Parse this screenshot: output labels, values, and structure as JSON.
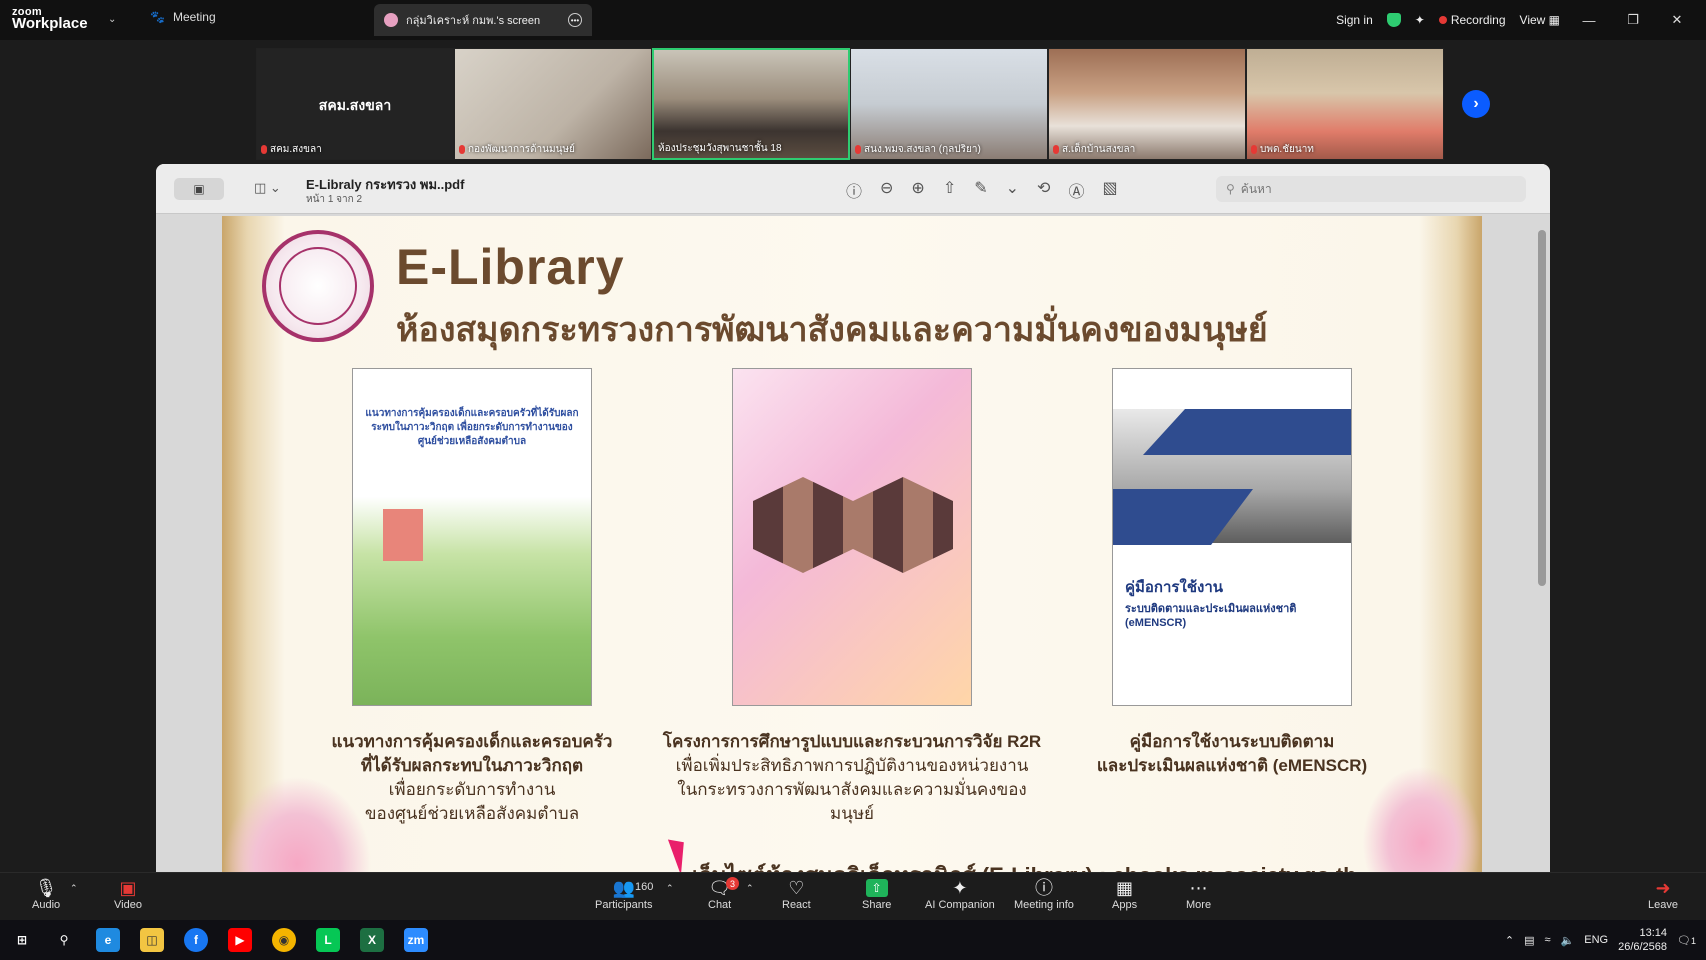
{
  "app": {
    "brand_line1": "zoom",
    "brand_line2": "Workplace",
    "meeting_tab": "Meeting",
    "screen_tab": "กลุ่มวิเคราะห์ กมพ.'s screen",
    "sign_in": "Sign in",
    "recording": "Recording",
    "view": "View"
  },
  "participants_strip": [
    {
      "name": "สคม.สงขลา",
      "big": "สคม.สงขลา",
      "active": false
    },
    {
      "name": "กองพัฒนาการด้านมนุษย์",
      "active": false
    },
    {
      "name": "ห้องประชุมวังสุพานชาชั้น 18",
      "active": true
    },
    {
      "name": "สนง.พมจ.สงขลา (กุลปริยา)",
      "active": false
    },
    {
      "name": "ส.เด็กบ้านสงขลา",
      "active": false
    },
    {
      "name": "บพด.ชัยนาท",
      "active": false
    }
  ],
  "viewer": {
    "file_name": "E-Libraly กระทรวง พม..pdf",
    "page_info": "หน้า 1 จาก 2",
    "search_placeholder": "ค้นหา"
  },
  "page": {
    "title": "E-Library",
    "subtitle": "ห้องสมุดกระทรวงการพัฒนาสังคมและความมั่นคงของมนุษย์",
    "card1_text": "แนวทางการคุ้มครองเด็กและครอบครัวที่ได้รับผลกระทบในภาวะวิกฤต เพื่อยกระดับการทำงานของศูนย์ช่วยเหลือสังคมตำบล",
    "card3_title": "คู่มือการใช้งาน",
    "card3_sub": "ระบบติดตามและประเมินผลแห่งชาติ (eMENSCR)",
    "captions": [
      {
        "bold1": "แนวทางการคุ้มครองเด็กและครอบครัว",
        "bold2": "ที่ได้รับผลกระทบในภาวะวิกฤต",
        "line3": "เพื่อยกระดับการทำงาน",
        "line4": "ของศูนย์ช่วยเหลือสังคมตำบล"
      },
      {
        "bold1": "โครงการการศึกษารูปแบบและกระบวนการวิจัย R2R",
        "line2": "เพื่อเพิ่มประสิทธิภาพการปฏิบัติงานของหน่วยงาน",
        "line3": "ในกระทรวงการพัฒนาสังคมและความมั่นคงของมนุษย์"
      },
      {
        "bold1": "คู่มือการใช้งานระบบติดตาม",
        "bold2": "และประเมินผลแห่งชาติ (eMENSCR)"
      }
    ],
    "website_line": "เว็บไซต์ห้องสมุดอิเล็กทรอนิกส์ (E-Library) : ebooks.m-society.go.th"
  },
  "toolbar": {
    "audio": "Audio",
    "video": "Video",
    "participants": "Participants",
    "participants_count": "160",
    "chat": "Chat",
    "chat_badge": "3",
    "react": "React",
    "share": "Share",
    "ai_companion": "AI Companion",
    "meeting_info": "Meeting info",
    "apps": "Apps",
    "more": "More",
    "leave": "Leave"
  },
  "taskbar": {
    "lang": "ENG",
    "time": "13:14",
    "date": "26/6/2568",
    "notif_count": "1"
  }
}
